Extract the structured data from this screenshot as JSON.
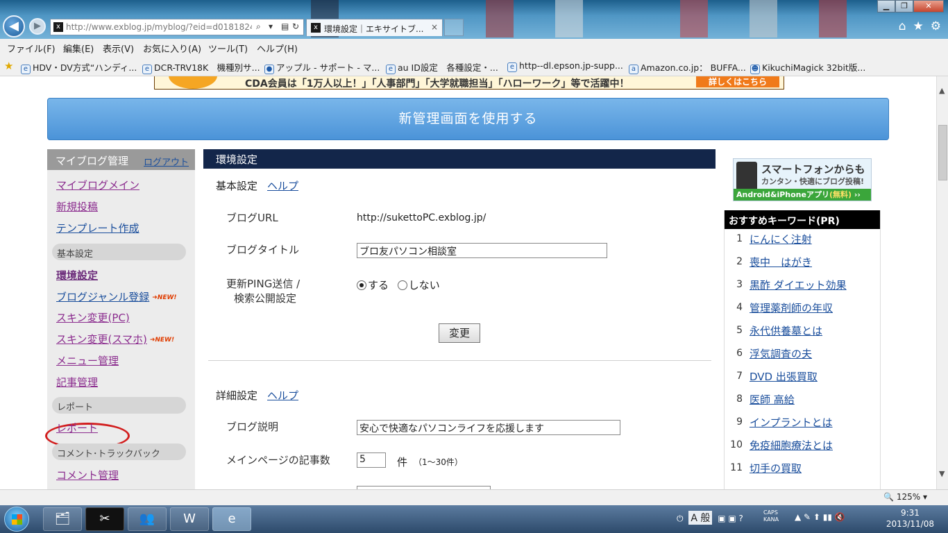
{
  "browser": {
    "url": "http://www.exblog.jp/myblog/?eid=d0181824",
    "tab_title": "環境設定｜エキサイトブ...",
    "tab_close": "×",
    "menu": [
      "ファイル(F)",
      "編集(E)",
      "表示(V)",
      "お気に入り(A)",
      "ツール(T)",
      "ヘルプ(H)"
    ],
    "favorites": [
      "HDV・DV方式“ハンディ...",
      "DCR-TRV18K　機種別サ...",
      "アップル - サポート - マ...",
      "au ID設定　各種設定・...",
      "http--dl.epson.jp-supp...",
      "Amazon.co.jp： BUFFA...",
      "KikuchiMagick 32bit版..."
    ],
    "zoom": "125%"
  },
  "banner": {
    "text": "CDA会員は「1万人以上！」「人事部門」「大学就職担当」「ハローワーク」等で活躍中！",
    "button": "詳しくはこちら"
  },
  "new_admin_button": "新管理画面を使用する",
  "sidebar": {
    "title": "マイブログ管理",
    "logout": "ログアウト",
    "links_top": [
      "マイブログメイン",
      "新規投稿",
      "テンプレート作成"
    ],
    "section_basic": "基本設定",
    "links_basic": [
      "環境設定",
      "ブログジャンル登録",
      "スキン変更(PC)",
      "スキン変更(スマホ)",
      "メニュー管理",
      "記事管理"
    ],
    "new_badge": "➜NEW!",
    "section_report": "レポート",
    "link_report": "レポート",
    "section_comment": "コメント･トラックバック",
    "link_comment": "コメント管理"
  },
  "main": {
    "header": "環境設定",
    "basic_title": "基本設定",
    "help": "ヘルプ",
    "blog_url_label": "ブログURL",
    "blog_url_value": "http://sukettoPC.exblog.jp/",
    "blog_title_label": "ブログタイトル",
    "blog_title_value": "ブロ友パソコン相談室",
    "ping_label_1": "更新PING送信 /",
    "ping_label_2": "検索公開設定",
    "radio_on": "する",
    "radio_off": "しない",
    "change_button": "変更",
    "detail_title": "詳細設定",
    "desc_label": "ブログ説明",
    "desc_value": "安心で快適なパソコンライフを応援します",
    "count_label": "メインページの記事数",
    "count_value": "5",
    "count_unit": "件",
    "count_hint": "（1〜30件）"
  },
  "right": {
    "ad_line1": "スマートフォンからも",
    "ad_line2": "カンタン・快適にブログ投稿!",
    "ad_line3": "Android&iPhoneアプリ",
    "ad_free": "(無料)",
    "keywords_title": "おすすめキーワード(PR)",
    "keywords": [
      {
        "num": "1",
        "text": "にんにく注射"
      },
      {
        "num": "2",
        "text": "喪中　はがき"
      },
      {
        "num": "3",
        "text": "黒酢 ダイエット効果"
      },
      {
        "num": "4",
        "text": "管理薬剤師の年収"
      },
      {
        "num": "5",
        "text": "永代供養墓とは"
      },
      {
        "num": "6",
        "text": "浮気調査の夫"
      },
      {
        "num": "7",
        "text": "DVD 出張買取"
      },
      {
        "num": "8",
        "text": "医師 高給"
      },
      {
        "num": "9",
        "text": "インプラントとは"
      },
      {
        "num": "10",
        "text": "免疫細胞療法とは"
      },
      {
        "num": "11",
        "text": "切手の買取"
      }
    ]
  },
  "taskbar": {
    "ime": "A 般",
    "caps": "CAPS",
    "kana": "KANA",
    "time": "9:31",
    "date": "2013/11/08"
  }
}
